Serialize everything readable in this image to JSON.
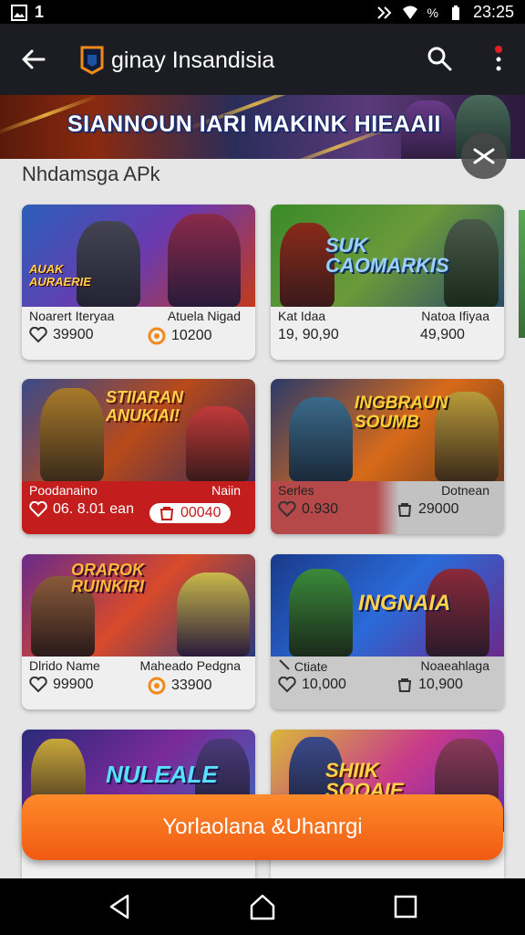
{
  "status_bar": {
    "notification_count": "1",
    "battery_label": "%",
    "time": "23:25"
  },
  "app_bar": {
    "title": "ginay Insandisia"
  },
  "banner": {
    "text": "SIANNOUN IARI MAKINK HIEAAII"
  },
  "section": {
    "title": "Nhdamsga APk"
  },
  "cards": [
    {
      "art_text": "AUAK\nAURAERIE",
      "left_name": "Noarert Iteryaa",
      "right_name": "Atuela Nigad",
      "left_value": "39900",
      "right_value": "10200",
      "right_icon": "coin-icon"
    },
    {
      "art_text": "SUK\nCAOMARKIS",
      "left_name": "Kat Idaa",
      "right_name": "Natoa Ifiyaa",
      "left_value": "19, 90,90",
      "right_value": "49,900",
      "right_icon": "none"
    },
    {
      "art_text": "STIIARAN\nANUKIAI!",
      "left_name": "Poodanaino",
      "right_name": "Naiin",
      "left_value": "06. 8.01 ean",
      "right_value": "00040",
      "right_icon": "bag-icon"
    },
    {
      "art_text": "INGBRAUN\nSOUMB",
      "left_name": "Serles",
      "right_name": "Dotnean",
      "left_value": "0.930",
      "right_value": "29000",
      "right_icon": "bag-icon"
    },
    {
      "art_text": "ORAROK\nRUINKIRI",
      "left_name": "Dlrido Name",
      "right_name": "Maheado Pedgna",
      "left_value": "99900",
      "right_value": "33900",
      "right_icon": "coin-icon"
    },
    {
      "art_text": "INGNAIA",
      "left_name": "Ctiate",
      "right_name": "Noaeahlaga",
      "left_value": "10,000",
      "right_value": "10,900",
      "right_icon": "bag-icon"
    },
    {
      "art_text": "NULEALE"
    },
    {
      "art_text": "SHIIK\nSOOAIE"
    }
  ],
  "cta": {
    "label": "Yorlaolana &Uhanrgi"
  },
  "colors": {
    "accent": "#f26a1b",
    "app_bar": "#1c1d22",
    "card_red": "#c31d1d"
  }
}
